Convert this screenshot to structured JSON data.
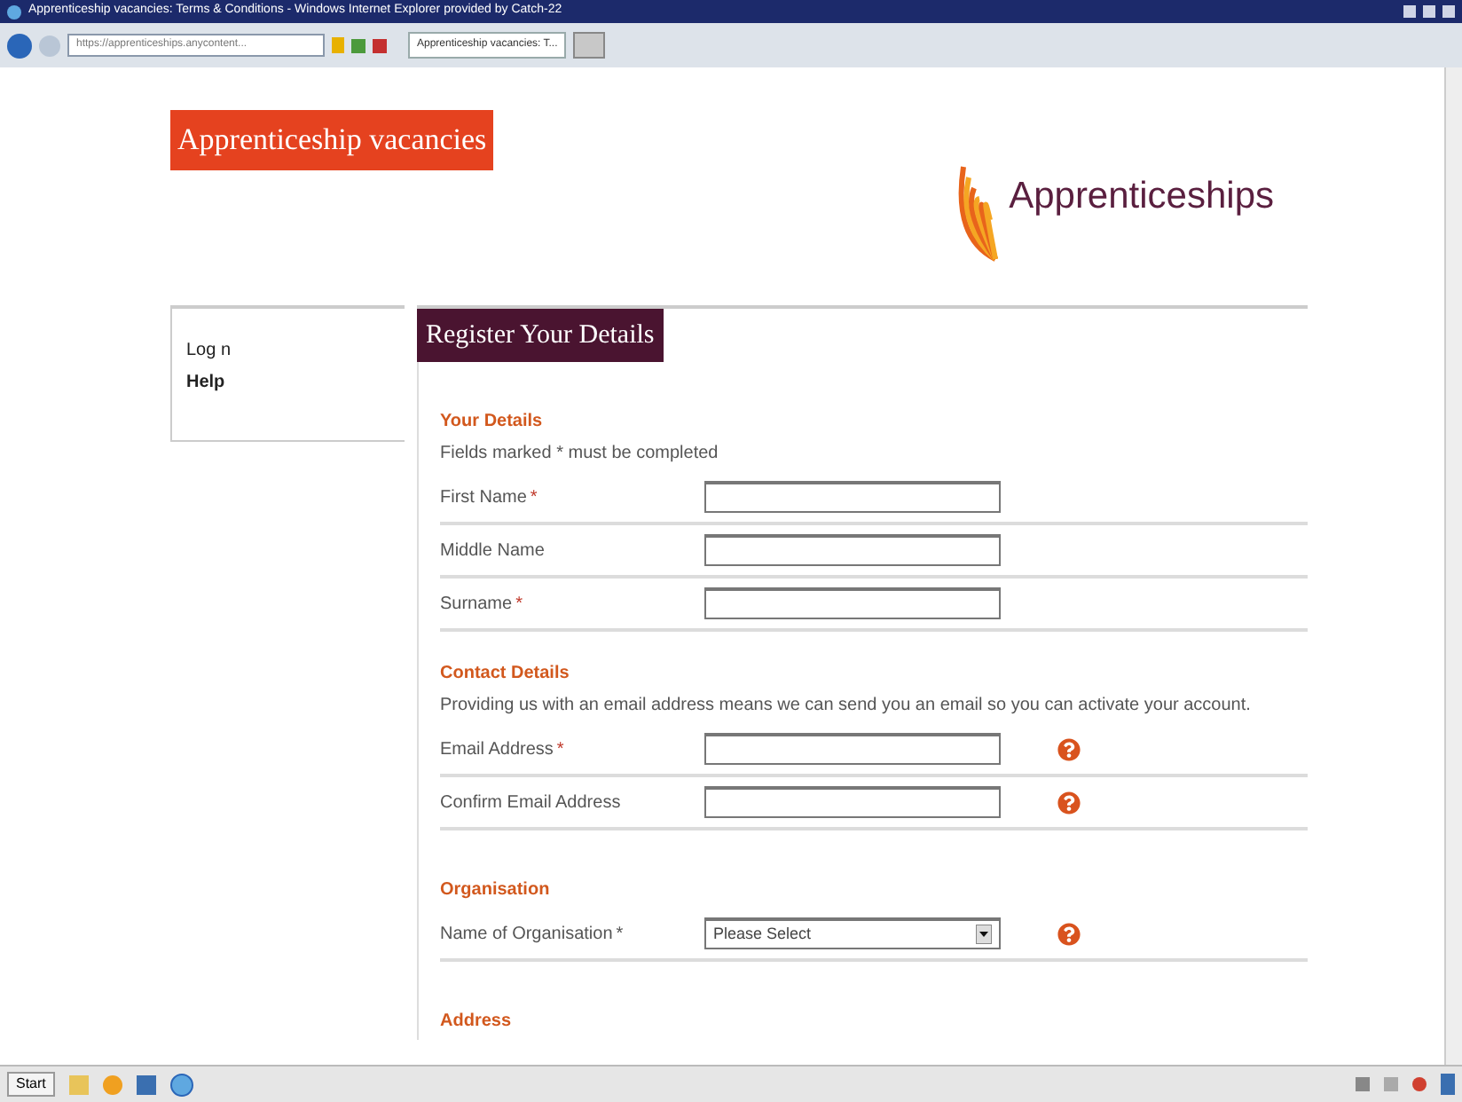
{
  "window": {
    "title": "Apprenticeship vacancies: Terms & Conditions - Windows Internet Explorer provided by Catch-22"
  },
  "toolbar": {
    "address": "https://apprenticeships.anycontent...",
    "tab": "Apprenticeship vacancies: T..."
  },
  "banner": "Apprenticeship vacancies",
  "logo": "Apprenticeships",
  "sidebar": {
    "items": [
      {
        "label": "Log n",
        "bold": false
      },
      {
        "label": "Help",
        "bold": true
      }
    ]
  },
  "page_title": "Register Your Details",
  "sections": [
    {
      "heading": "Your Details",
      "note": "Fields marked * must be completed",
      "fields": [
        {
          "kind": "text",
          "label": "First Name",
          "marker": "*"
        },
        {
          "kind": "text",
          "label": "Middle Name"
        },
        {
          "kind": "text",
          "label": "Surname",
          "marker": "*"
        }
      ]
    },
    {
      "heading": "Contact Details",
      "note": "Providing us with an email address means we can send you an email so you can activate your account.",
      "fields": [
        {
          "kind": "text",
          "label": "Email Address",
          "marker": "*",
          "help": true
        },
        {
          "kind": "text",
          "label": "Confirm Email Address",
          "help": true
        }
      ]
    },
    {
      "heading": "Organisation",
      "fields": [
        {
          "kind": "select",
          "label": "Name of Organisation",
          "marker": "*",
          "value": "Please Select",
          "help": true
        }
      ]
    },
    {
      "heading": "Address"
    }
  ],
  "taskbar": {
    "start": "Start"
  }
}
